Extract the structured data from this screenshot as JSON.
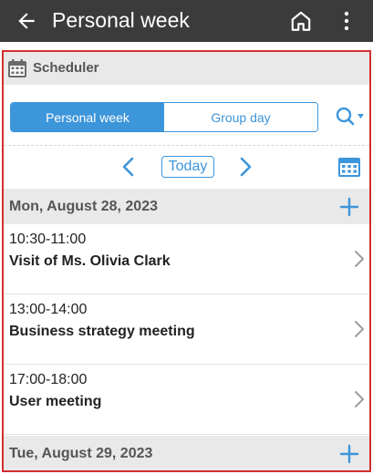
{
  "appbar": {
    "title": "Personal week",
    "icons": {
      "back": "arrow-left-icon",
      "home": "home-icon",
      "more": "more-vertical-icon"
    }
  },
  "scheduler": {
    "header_label": "Scheduler",
    "header_icon": "calendar-icon"
  },
  "view_switch": {
    "options": [
      {
        "label": "Personal week",
        "active": true
      },
      {
        "label": "Group day",
        "active": false
      }
    ]
  },
  "nav": {
    "today_label": "Today",
    "icons": {
      "prev": "chevron-left-icon",
      "next": "chevron-right-icon",
      "calendar": "calendar-grid-icon",
      "search": "search-dropdown-icon"
    }
  },
  "days": [
    {
      "label": "Mon, August 28, 2023",
      "events": [
        {
          "time": "10:30-11:00",
          "title": "Visit of Ms. Olivia Clark"
        },
        {
          "time": "13:00-14:00",
          "title": "Business strategy meeting"
        },
        {
          "time": "17:00-18:00",
          "title": "User meeting"
        }
      ]
    },
    {
      "label": "Tue, August 29, 2023",
      "events": []
    }
  ],
  "colors": {
    "appbar_bg": "#3b3b3b",
    "accent": "#3d95da",
    "highlight_border": "#d32f2f",
    "section_bg": "#e9e9e9"
  }
}
